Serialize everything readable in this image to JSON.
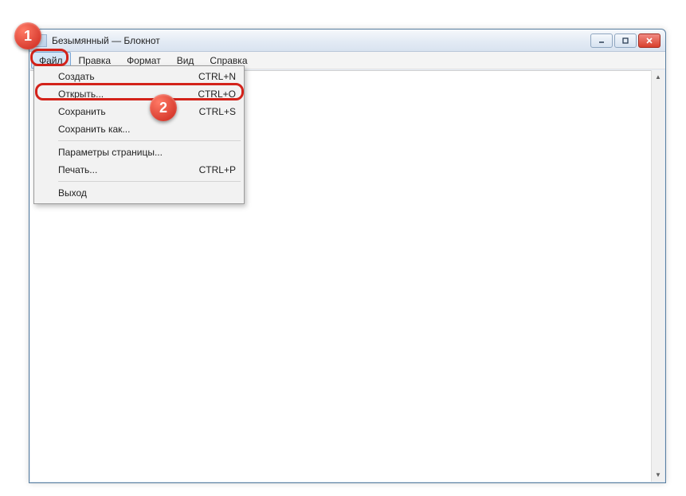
{
  "window": {
    "title": "Безымянный — Блокнот"
  },
  "menubar": {
    "file": "Файл",
    "edit": "Правка",
    "format": "Формат",
    "view": "Вид",
    "help": "Справка"
  },
  "file_menu": {
    "new": {
      "label": "Создать",
      "shortcut": "CTRL+N"
    },
    "open": {
      "label": "Открыть...",
      "shortcut": "CTRL+O"
    },
    "save": {
      "label": "Сохранить",
      "shortcut": "CTRL+S"
    },
    "save_as": {
      "label": "Сохранить как..."
    },
    "page_setup": {
      "label": "Параметры страницы..."
    },
    "print": {
      "label": "Печать...",
      "shortcut": "CTRL+P"
    },
    "exit": {
      "label": "Выход"
    }
  },
  "annotations": {
    "step1": "1",
    "step2": "2"
  }
}
